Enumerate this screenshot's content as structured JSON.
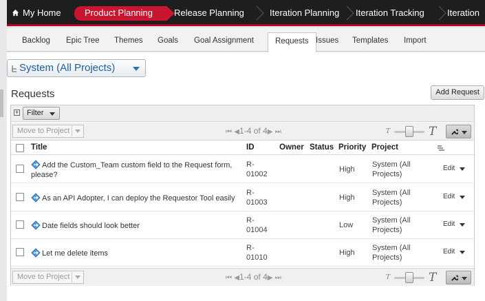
{
  "topnav": {
    "home": "My Home",
    "tabs": [
      "Product Planning",
      "Release Planning",
      "Iteration Planning",
      "Iteration Tracking",
      "Iteration"
    ]
  },
  "subnav": {
    "tabs": [
      "Backlog",
      "Epic Tree",
      "Themes",
      "Goals",
      "Goal Assignment",
      "Requests",
      "Issues",
      "Templates",
      "Import"
    ],
    "active": "Requests"
  },
  "project_selector": {
    "label": "System (All Projects)"
  },
  "section_title": "Requests",
  "add_button": "Add Request",
  "filter_label": "Filter",
  "move_label": "Move to Project",
  "pager_text": "1-4 of 4",
  "columns": {
    "title": "Title",
    "id": "ID",
    "owner": "Owner",
    "status": "Status",
    "priority": "Priority",
    "project": "Project"
  },
  "rows": [
    {
      "title_line1": "Add the Custom_Team custom field to the Request form,",
      "title_line2": "please?",
      "id_line1": "R-",
      "id_line2": "01002",
      "priority": "High",
      "project_line1": "System (All",
      "project_line2": "Projects)",
      "edit": "Edit"
    },
    {
      "title_line1": "As an API Adopter, I can deploy the Requestor Tool easily",
      "title_line2": "",
      "id_line1": "R-",
      "id_line2": "01003",
      "priority": "High",
      "project_line1": "System (All",
      "project_line2": "Projects)",
      "edit": "Edit"
    },
    {
      "title_line1": "Date fields should look better",
      "title_line2": "",
      "id_line1": "R-",
      "id_line2": "01004",
      "priority": "Low",
      "project_line1": "System (All",
      "project_line2": "Projects)",
      "edit": "Edit"
    },
    {
      "title_line1": "Let me delete items",
      "title_line2": "",
      "id_line1": "R-",
      "id_line2": "01010",
      "priority": "High",
      "project_line1": "System (All",
      "project_line2": "Projects)",
      "edit": "Edit"
    }
  ],
  "colors": {
    "brand_red": "#c9152e",
    "nav_dark": "#1e1e1e",
    "link_blue": "#1f5ea8"
  }
}
